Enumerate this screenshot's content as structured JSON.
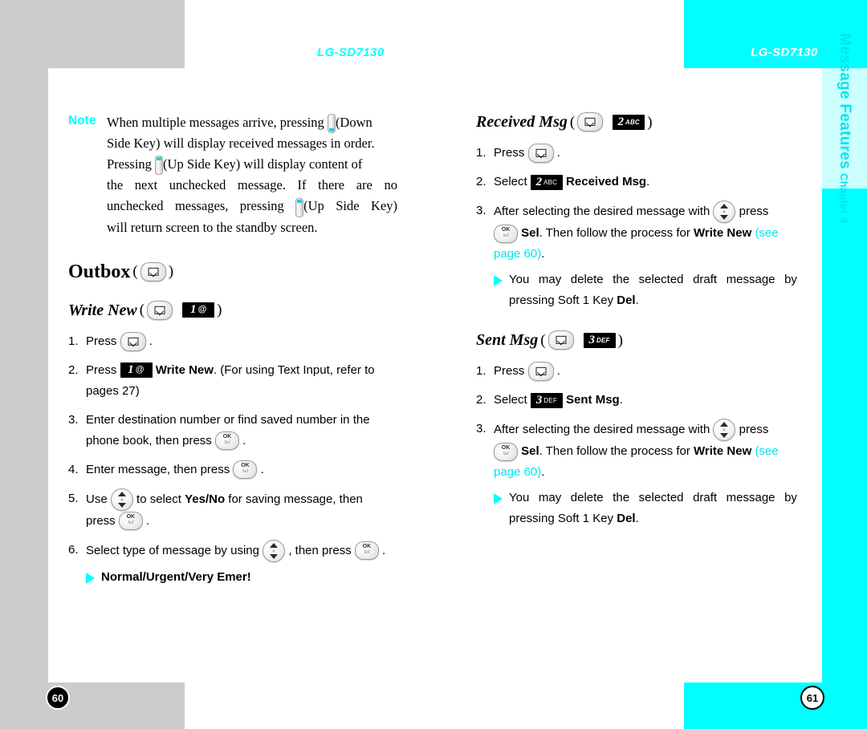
{
  "header": {
    "left_title": "LG-SD7130",
    "right_title": "LG-SD7130"
  },
  "chapter_tab": {
    "number": "Chapter 4",
    "name": "Message Features"
  },
  "page_numbers": {
    "left": "60",
    "right": "61"
  },
  "note": {
    "label": "Note",
    "lines": [
      [
        "When multiple messages arrive, pressing",
        "(Down"
      ],
      [
        "Side Key) will display received messages in order."
      ],
      [
        "Pressing",
        "(Up Side Key) will display content of"
      ],
      [
        "the",
        "next",
        "unchecked",
        "message.",
        "If",
        "there",
        "are",
        "no"
      ],
      [
        "unchecked",
        "messages,",
        "pressing",
        "(Up",
        "Side",
        "Key)"
      ],
      [
        "will return screen to the standby screen."
      ]
    ]
  },
  "outbox": {
    "title": "Outbox",
    "write_new": {
      "title": "Write New",
      "steps": [
        {
          "num": "1.",
          "pre": "Press",
          "post": "."
        },
        {
          "num": "2.",
          "pre": "Press",
          "bold": "Write New",
          "after": ". (For using Text Input, refer to",
          "line2": "pages 27)"
        },
        {
          "num": "3.",
          "pre": "Enter destination number or find saved number in the",
          "line2_pre": "phone book, then press",
          "line2_post": "."
        },
        {
          "num": "4.",
          "pre": "Enter message, then press",
          "post": "."
        },
        {
          "num": "5.",
          "pre": "Use",
          "mid": "to select",
          "bold": "Yes/No",
          "after": "for saving message, then",
          "line2_pre": "press",
          "line2_post": "."
        },
        {
          "num": "6.",
          "pre": "Select type of message by using",
          "mid": ", then press",
          "post": "."
        }
      ],
      "bullet": "Normal/Urgent/Very Emer!"
    }
  },
  "received_msg": {
    "title": "Received Msg",
    "steps": [
      {
        "num": "1.",
        "pre": "Press",
        "post": "."
      },
      {
        "num": "2.",
        "pre": "Select",
        "bold": "Received Msg",
        "after": "."
      },
      {
        "num": "3.",
        "pre": "After selecting the desired message with",
        "post": "press",
        "l2_bold1": "Sel",
        "l2_mid": ". Then follow the process for",
        "l2_bold2": "Write New",
        "l2_link": "(see",
        "l3_link": "page 60)",
        "l3_end": "."
      }
    ],
    "bullet_lines": [
      [
        "You",
        "may",
        "delete",
        "the",
        "selected",
        "draft",
        "message",
        "by"
      ],
      [
        "pressing Soft 1 Key",
        "Del",
        "."
      ]
    ]
  },
  "sent_msg": {
    "title": "Sent Msg",
    "steps": [
      {
        "num": "1.",
        "pre": "Press",
        "post": "."
      },
      {
        "num": "2.",
        "pre": "Select",
        "bold": "Sent Msg",
        "after": "."
      },
      {
        "num": "3.",
        "pre": "After selecting the desired message with",
        "post": "press",
        "l2_bold1": "Sel",
        "l2_mid": ". Then follow the process for",
        "l2_bold2": "Write New",
        "l2_link": "(see",
        "l3_link": "page 60)",
        "l3_end": "."
      }
    ],
    "bullet_lines": [
      [
        "You",
        "may",
        "delete",
        "the",
        "selected",
        "draft",
        "message",
        "by"
      ],
      [
        "pressing Soft 1 Key",
        "Del",
        "."
      ]
    ]
  },
  "keys": {
    "key1": {
      "digit": "1",
      "label": "@"
    },
    "key2": {
      "digit": "2",
      "label": "ABC"
    },
    "key3": {
      "digit": "3",
      "label": "DEF"
    },
    "ok": {
      "top": "OK",
      "bottom": "Sel"
    }
  },
  "colors": {
    "accent_cyan": "#00ffff",
    "link_cyan": "#00e5ee",
    "gray_block": "#cccccc",
    "tab_light": "#ccffff"
  }
}
